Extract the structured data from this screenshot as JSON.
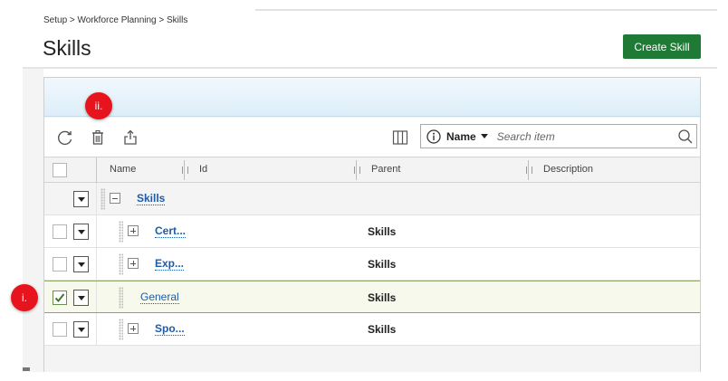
{
  "breadcrumb": "Setup > Workforce Planning > Skills",
  "page_title": "Skills",
  "create_button": "Create Skill",
  "toolbar": {
    "refresh_icon": "refresh-icon",
    "delete_icon": "trash-icon",
    "export_icon": "export-icon",
    "columns_icon": "columns-icon"
  },
  "search": {
    "field": "Name",
    "placeholder": "Search item"
  },
  "columns": [
    "Name",
    "Id",
    "Parent",
    "Description"
  ],
  "rows": [
    {
      "name": "Skills",
      "parent": "",
      "type": "group"
    },
    {
      "name": "Cert...",
      "parent": "Skills",
      "checked": false
    },
    {
      "name": "Exp...",
      "parent": "Skills",
      "checked": false
    },
    {
      "name": "General",
      "parent": "Skills",
      "checked": true
    },
    {
      "name": "Spo...",
      "parent": "Skills",
      "checked": false
    }
  ],
  "annotations": {
    "delete_marker": "ii.",
    "row_marker": "i."
  },
  "colors": {
    "primary_button": "#1f7a35",
    "link": "#1f5ca8",
    "marker": "#e8141d",
    "selected_row": "#f6f9ec"
  }
}
